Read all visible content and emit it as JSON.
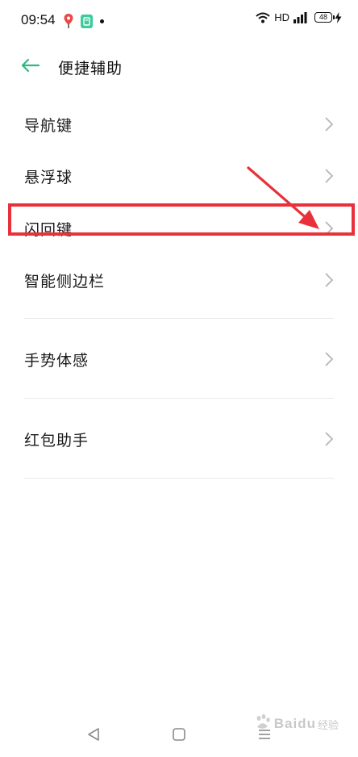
{
  "status_bar": {
    "time": "09:54",
    "network_label": "HD",
    "battery_level": "48",
    "icons": [
      "location-pin-icon",
      "app-notification-icon",
      "dot-icon",
      "wifi-icon",
      "signal-icon",
      "battery-icon",
      "charging-icon"
    ]
  },
  "header": {
    "back_icon": "back-arrow-icon",
    "title": "便捷辅助"
  },
  "menu": {
    "items": [
      {
        "label": "导航键"
      },
      {
        "label": "悬浮球"
      },
      {
        "label": "闪回键"
      },
      {
        "label": "智能侧边栏"
      },
      {
        "label": "手势体感"
      },
      {
        "label": "红包助手"
      }
    ]
  },
  "annotation": {
    "highlight_color": "#e8313a",
    "highlighted_item": "闪回键"
  },
  "nav_bar": {
    "icons": [
      "back-triangle-icon",
      "home-square-icon",
      "recent-menu-icon"
    ]
  },
  "watermark": {
    "brand": "Baidu",
    "sub": "经验"
  },
  "colors": {
    "accent": "#2fb882",
    "text": "#1a1a1a",
    "chevron": "#b5b5b5"
  }
}
